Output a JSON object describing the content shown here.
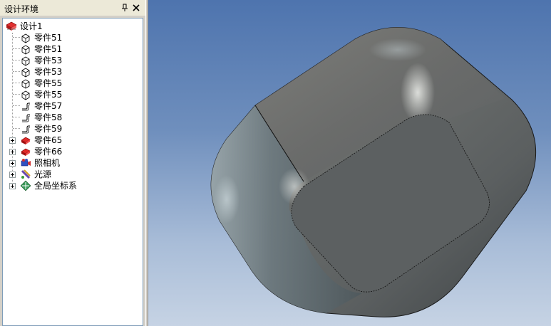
{
  "panel": {
    "title": "设计环境",
    "pin_icon": "pin-icon",
    "close_icon": "close-icon"
  },
  "tree": {
    "root": {
      "label": "设计1",
      "icon": "design-icon"
    },
    "items": [
      {
        "label": "零件51",
        "icon": "part-box-icon"
      },
      {
        "label": "零件51",
        "icon": "part-box-icon"
      },
      {
        "label": "零件53",
        "icon": "part-box-icon"
      },
      {
        "label": "零件53",
        "icon": "part-box-icon"
      },
      {
        "label": "零件55",
        "icon": "part-box-icon"
      },
      {
        "label": "零件55",
        "icon": "part-box-icon"
      },
      {
        "label": "零件57",
        "icon": "part-curve-icon"
      },
      {
        "label": "零件58",
        "icon": "part-curve-icon"
      },
      {
        "label": "零件59",
        "icon": "part-curve-icon"
      },
      {
        "label": "零件65",
        "icon": "part-red-icon"
      },
      {
        "label": "零件66",
        "icon": "part-red-icon"
      },
      {
        "label": "照相机",
        "icon": "camera-icon"
      },
      {
        "label": "光源",
        "icon": "light-icon"
      },
      {
        "label": "全局坐标系",
        "icon": "coordinate-system-icon"
      }
    ]
  },
  "colors": {
    "tree_border": "#7f9db9",
    "viewport_top": "#4e74ae",
    "viewport_bottom": "#c6d3e4",
    "part_red": "#d42020"
  }
}
